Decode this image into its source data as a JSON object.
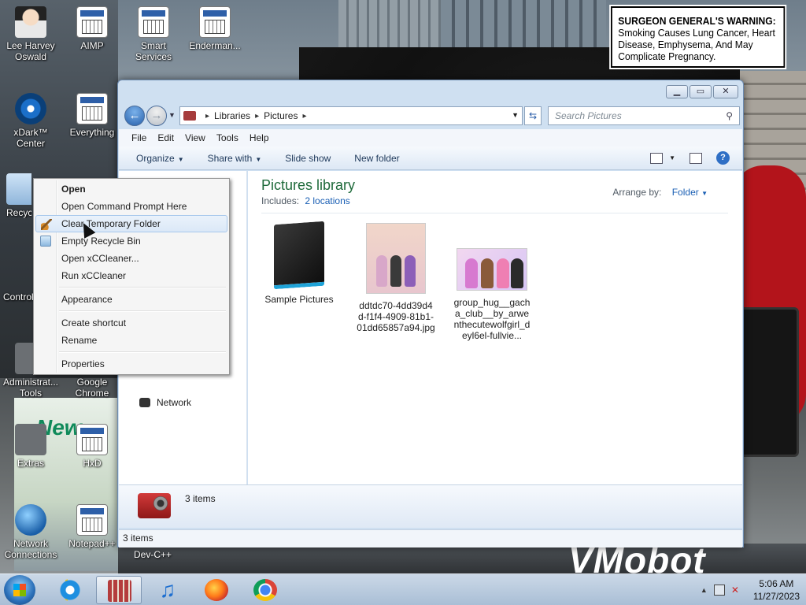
{
  "warning": {
    "prefix": "SURGEON GENERAL'S WARNING:",
    "text": "Smoking Causes Lung Cancer, Heart Disease, Emphysema, And May Complicate Pregnancy."
  },
  "background_texts": {
    "vm": "VMobot",
    "devcpp": "Dev-C++",
    "new": "New"
  },
  "desktop_icons": [
    {
      "label": "Lee Harvey Oswald"
    },
    {
      "label": "AIMP"
    },
    {
      "label": "Smart Services"
    },
    {
      "label": "Enderman..."
    },
    {
      "label": "xDark™ Center"
    },
    {
      "label": "Everything"
    },
    {
      "label": "Recycl"
    },
    {
      "label": "Control"
    },
    {
      "label": "Administrat... Tools"
    },
    {
      "label": "Google Chrome"
    },
    {
      "label": "Extras"
    },
    {
      "label": "HxD"
    },
    {
      "label": "Network Connections"
    },
    {
      "label": "Notepad++"
    }
  ],
  "explorer": {
    "breadcrumb": [
      "Libraries",
      "Pictures"
    ],
    "search_placeholder": "Search Pictures",
    "menu": [
      "File",
      "Edit",
      "View",
      "Tools",
      "Help"
    ],
    "toolbar": {
      "organize": "Organize",
      "share": "Share with",
      "slideshow": "Slide show",
      "newfolder": "New folder"
    },
    "nav": {
      "network": "Network"
    },
    "library_title": "Pictures library",
    "includes_label": "Includes:",
    "includes_link": "2 locations",
    "arrange_label": "Arrange by:",
    "arrange_value": "Folder",
    "items": [
      {
        "name": "Sample Pictures"
      },
      {
        "name": "ddtdc70-4dd39d4d-f1f4-4909-81b1-01dd65857a94.jpg"
      },
      {
        "name": "group_hug__gacha_club__by_arwenthecutewolfgirl_deyl6el-fullvie..."
      }
    ],
    "details_count": "3 items",
    "status_count": "3 items"
  },
  "context_menu": {
    "items": [
      {
        "label": "Open",
        "bold": true
      },
      {
        "label": "Open Command Prompt Here"
      },
      {
        "label": "Clear Temporary Folder",
        "highlighted": true,
        "icon": "broom-icon"
      },
      {
        "label": "Empty Recycle Bin",
        "icon": "recycle-icon"
      },
      {
        "label": "Open xCCleaner..."
      },
      {
        "label": "Run xCCleaner"
      },
      {
        "separator": true
      },
      {
        "label": "Appearance"
      },
      {
        "separator": true
      },
      {
        "label": "Create shortcut"
      },
      {
        "label": "Rename"
      },
      {
        "separator": true
      },
      {
        "label": "Properties"
      }
    ]
  },
  "taskbar": {
    "time": "5:06 AM",
    "date": "11/27/2023"
  },
  "colors": {
    "accent": "#1a5fb4",
    "library_title": "#1e6a3a",
    "taskbar": "#b9cbe0"
  }
}
